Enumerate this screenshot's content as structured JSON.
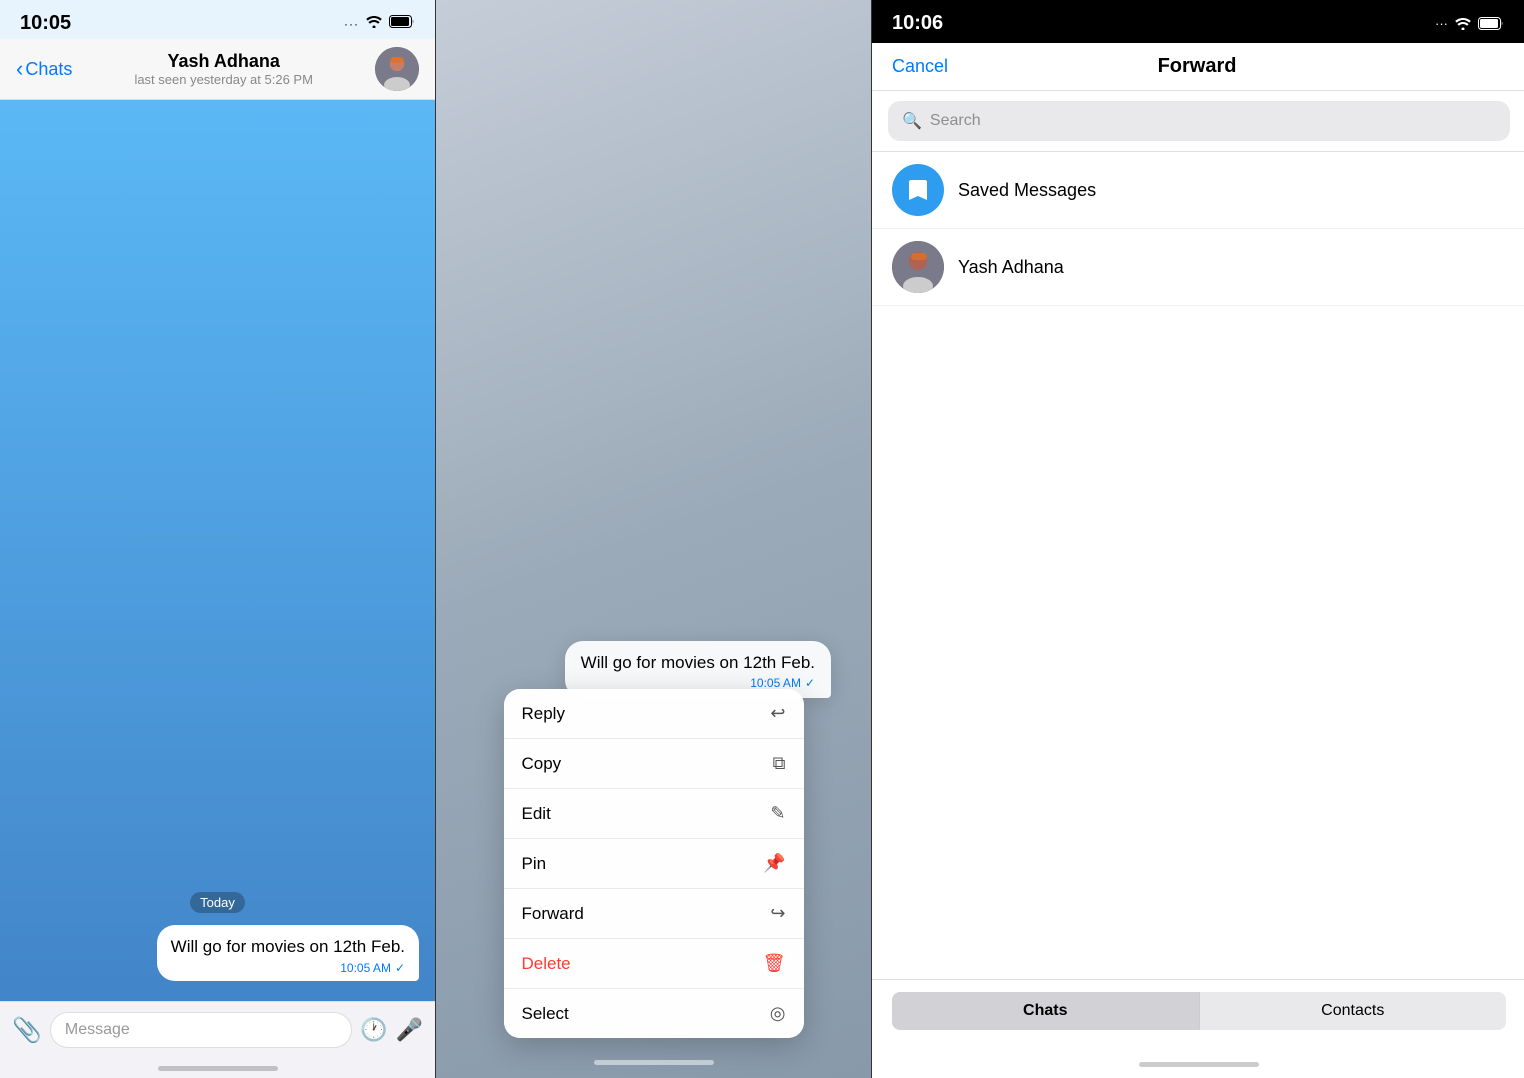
{
  "panel1": {
    "statusBar": {
      "time": "10:05",
      "icons": [
        "···",
        "WiFi",
        "Battery"
      ]
    },
    "header": {
      "backLabel": "Chats",
      "contactName": "Yash Adhana",
      "contactStatus": "last seen yesterday at 5:26 PM"
    },
    "messages": [
      {
        "dateLabel": "Today",
        "text": "Will go for movies on 12th Feb.",
        "time": "10:05 AM",
        "check": "✓"
      }
    ],
    "inputBar": {
      "placeholder": "Message"
    }
  },
  "panel2": {
    "bubble": {
      "text": "Will go for movies on 12th Feb.",
      "time": "10:05 AM",
      "check": "✓"
    },
    "contextMenu": {
      "items": [
        {
          "label": "Reply",
          "icon": "↩",
          "isDelete": false
        },
        {
          "label": "Copy",
          "icon": "⧉",
          "isDelete": false
        },
        {
          "label": "Edit",
          "icon": "✎",
          "isDelete": false
        },
        {
          "label": "Pin",
          "icon": "📌",
          "isDelete": false
        },
        {
          "label": "Forward",
          "icon": "↪",
          "isDelete": false
        },
        {
          "label": "Delete",
          "icon": "🗑",
          "isDelete": true
        },
        {
          "label": "Select",
          "icon": "◎",
          "isDelete": false
        }
      ]
    }
  },
  "panel3": {
    "statusBar": {
      "time": "10:06",
      "icons": [
        "···",
        "WiFi",
        "Battery"
      ]
    },
    "header": {
      "cancelLabel": "Cancel",
      "title": "Forward"
    },
    "search": {
      "placeholder": "Search"
    },
    "contacts": [
      {
        "name": "Saved Messages",
        "type": "saved",
        "icon": "🔖"
      },
      {
        "name": "Yash Adhana",
        "type": "user",
        "icon": "👤"
      }
    ],
    "bottomTabs": [
      {
        "label": "Chats",
        "active": true
      },
      {
        "label": "Contacts",
        "active": false
      }
    ]
  }
}
